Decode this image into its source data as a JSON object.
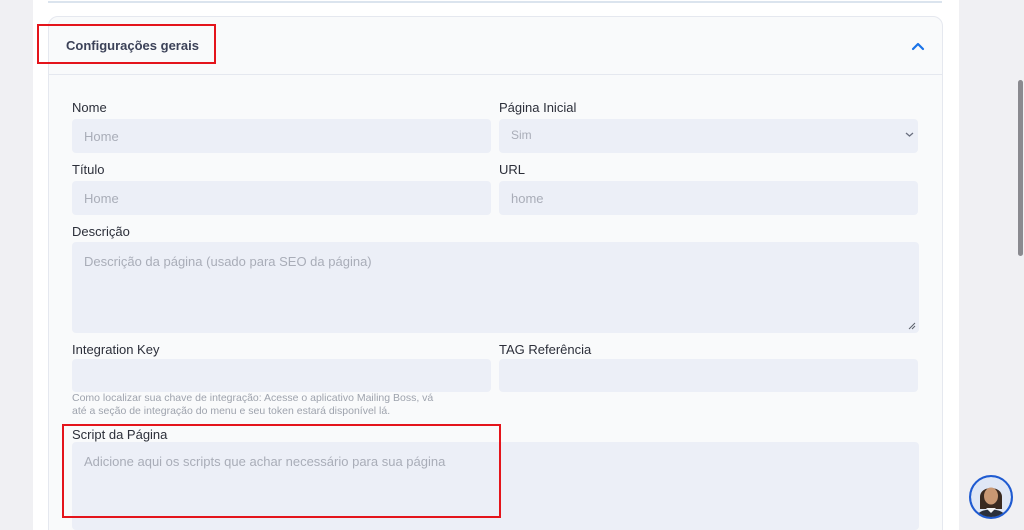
{
  "panel": {
    "title": "Configurações gerais"
  },
  "fields": {
    "nome": {
      "label": "Nome",
      "placeholder": "Home"
    },
    "pagina_inicial": {
      "label": "Página Inicial",
      "value": "Sim"
    },
    "titulo": {
      "label": "Título",
      "placeholder": "Home"
    },
    "url": {
      "label": "URL",
      "placeholder": "home"
    },
    "descricao": {
      "label": "Descrição",
      "placeholder": "Descrição da página (usado para SEO da página)"
    },
    "integration_key": {
      "label": "Integration Key",
      "help_line1": "Como localizar sua chave de integração: Acesse o aplicativo Mailing Boss, vá",
      "help_line2": "até a seção de integração do menu e seu token estará disponível lá."
    },
    "tag_referencia": {
      "label": "TAG Referência"
    },
    "script_pagina": {
      "label": "Script da Página",
      "placeholder": "Adicione aqui os scripts que achar necessário para sua página"
    }
  },
  "colors": {
    "highlight": "#e4141b",
    "accent": "#1a73e8",
    "input_bg": "#eceff7"
  },
  "icons": {
    "collapse": "chevron-up-icon",
    "select": "chevron-down-icon",
    "support": "support-avatar-icon"
  }
}
